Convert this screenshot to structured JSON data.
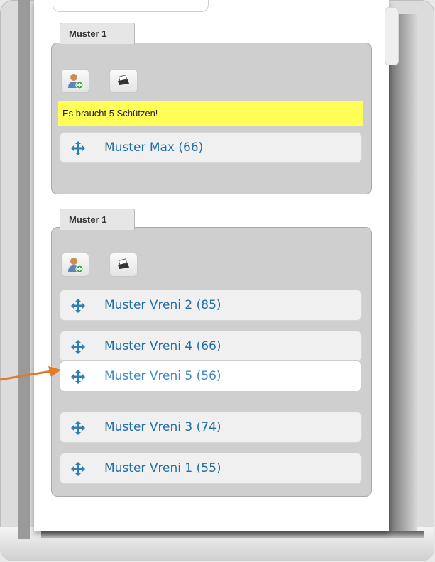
{
  "groups": [
    {
      "title": "Muster 1",
      "warning": "Es braucht 5 Schützen!",
      "members": [
        "Muster Max (66)"
      ]
    },
    {
      "title": "Muster 1",
      "members": [
        "Muster Vreni 2 (85)",
        "Muster Vreni 4 (66)",
        "Muster Vreni 5 (56)",
        "Muster Vreni 3 (74)",
        "Muster Vreni 1 (55)"
      ]
    }
  ],
  "icons": {
    "add_person": "add-person-icon",
    "print": "printer-icon",
    "move": "move-arrows-icon"
  },
  "colors": {
    "warning_bg": "#ffff57",
    "member_text": "#1f6ea8",
    "arrow": "#e07b2a"
  }
}
